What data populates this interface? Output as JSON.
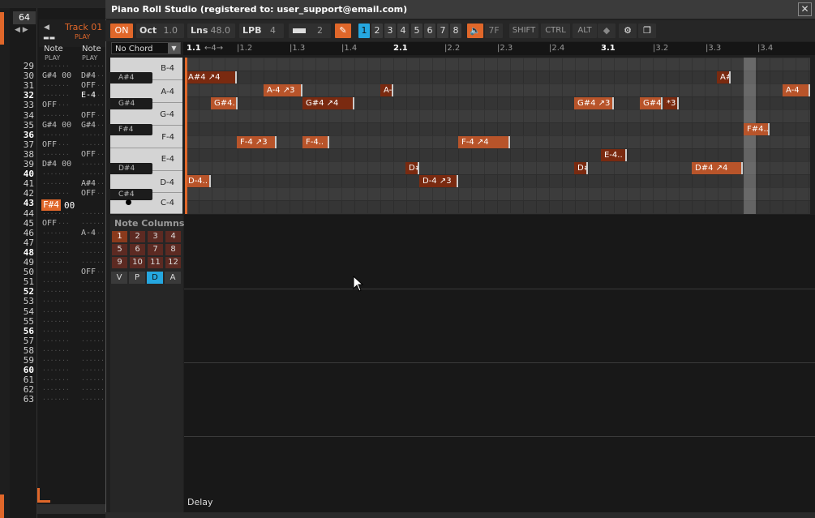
{
  "window": {
    "title": "Piano Roll Studio  (registered to: user_support@email.com)",
    "close": "✕"
  },
  "tracker": {
    "counter": "64",
    "track_name": "Track 01",
    "track_play": "PLAY",
    "col1_header": "Note",
    "col1_sub": "PLAY",
    "col2_header": "Note",
    "col2_sub": "PLAY",
    "cursor_note": "F#4",
    "cursor_vol": "00",
    "line_numbers": [
      "29",
      "30",
      "31",
      "32",
      "33",
      "34",
      "35",
      "36",
      "37",
      "38",
      "39",
      "40",
      "41",
      "42",
      "43",
      "44",
      "45",
      "46",
      "47",
      "48",
      "49",
      "50",
      "51",
      "52",
      "53",
      "54",
      "55",
      "56",
      "57",
      "58",
      "59",
      "60",
      "61",
      "62",
      "63"
    ],
    "col1_cells": [
      {
        "row": 1,
        "text": "G#4 00"
      },
      {
        "row": 4,
        "text": "OFF"
      },
      {
        "row": 6,
        "text": "G#4 00"
      },
      {
        "row": 8,
        "text": "OFF"
      },
      {
        "row": 10,
        "text": "D#4 00"
      },
      {
        "row": 16,
        "text": "OFF"
      }
    ],
    "col2_cells": [
      {
        "row": 1,
        "text": "D#4"
      },
      {
        "row": 2,
        "text": "OFF"
      },
      {
        "row": 3,
        "text": "E-4"
      },
      {
        "row": 5,
        "text": "OFF"
      },
      {
        "row": 6,
        "text": "G#4"
      },
      {
        "row": 9,
        "text": "OFF"
      },
      {
        "row": 12,
        "text": "A#4"
      },
      {
        "row": 13,
        "text": "OFF"
      },
      {
        "row": 17,
        "text": "A-4"
      },
      {
        "row": 21,
        "text": "OFF"
      }
    ]
  },
  "toolbar": {
    "on": "ON",
    "oct_label": "Oct",
    "oct_value": "1.0",
    "lns_label": "Lns",
    "lns_value": "48.0",
    "lpb_label": "LPB",
    "lpb_value": "4",
    "step_value": "2",
    "tracks": [
      "1",
      "2",
      "3",
      "4",
      "5",
      "6",
      "7",
      "8"
    ],
    "vel_value": "7F",
    "shift": "SHIFT",
    "ctrl": "CTRL",
    "alt": "ALT"
  },
  "chord": {
    "selected": "No Chord"
  },
  "ruler": {
    "labels": [
      {
        "text": "1.1",
        "major": true
      },
      {
        "text": "←4→",
        "major": false
      },
      {
        "text": "|1.2",
        "major": false
      },
      {
        "text": "|1.3",
        "major": false
      },
      {
        "text": "|1.4",
        "major": false
      },
      {
        "text": "2.1",
        "major": true
      },
      {
        "text": "|2.2",
        "major": false
      },
      {
        "text": "|2.3",
        "major": false
      },
      {
        "text": "|2.4",
        "major": false
      },
      {
        "text": "3.1",
        "major": true
      },
      {
        "text": "|3.2",
        "major": false
      },
      {
        "text": "|3.3",
        "major": false
      },
      {
        "text": "|3.4",
        "major": false
      }
    ]
  },
  "keyboard": {
    "white": [
      "B-4",
      "A-4",
      "G-4",
      "F-4",
      "E-4",
      "D-4",
      "C-4"
    ],
    "black": [
      "A#4",
      "G#4",
      "F#4",
      "D#4",
      "C#4"
    ]
  },
  "notes": [
    {
      "text": "A#4 ↗4",
      "style": "dk"
    },
    {
      "text": "A#",
      "style": "dk"
    },
    {
      "text": "A-4 ↗3",
      "style": "md"
    },
    {
      "text": "A-",
      "style": "dk"
    },
    {
      "text": "A-4",
      "style": "md"
    },
    {
      "text": "G#4.",
      "style": "md"
    },
    {
      "text": "G#4 ↗4",
      "style": "dk"
    },
    {
      "text": "G#4 ↗3",
      "style": "md"
    },
    {
      "text": "G#4.",
      "style": "md"
    },
    {
      "text": "*3",
      "style": "dk"
    },
    {
      "text": "F#4..",
      "style": "md"
    },
    {
      "text": "F-4 ↗3",
      "style": "md"
    },
    {
      "text": "F-4..",
      "style": "md"
    },
    {
      "text": "F-4 ↗4",
      "style": "md"
    },
    {
      "text": "E-4..",
      "style": "dk"
    },
    {
      "text": "D#",
      "style": "dk"
    },
    {
      "text": "D#",
      "style": "dk"
    },
    {
      "text": "D#4 ↗4",
      "style": "md"
    },
    {
      "text": "D-4..",
      "style": "md"
    },
    {
      "text": "D-4 ↗3",
      "style": "dk"
    }
  ],
  "note_columns": {
    "title": "Note Columns",
    "buttons": [
      "1",
      "2",
      "3",
      "4",
      "5",
      "6",
      "7",
      "8",
      "9",
      "10",
      "11",
      "12"
    ],
    "modes": [
      "V",
      "P",
      "D",
      "A"
    ],
    "selected_mode": "D"
  },
  "automation": {
    "lane_label": "Delay"
  },
  "colors": {
    "accent": "#e0672a",
    "selected": "#25a7e0",
    "note_dark": "#7a2a10",
    "note_mid": "#b8542a"
  }
}
